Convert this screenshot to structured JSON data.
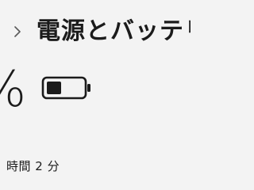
{
  "header": {
    "title": "電源とバッテリ",
    "chevron_icon": "chevron-right-icon"
  },
  "battery": {
    "percent_text": "%",
    "icon": "battery-icon",
    "level": 0.4,
    "remaining_text": "時間 2 分"
  }
}
